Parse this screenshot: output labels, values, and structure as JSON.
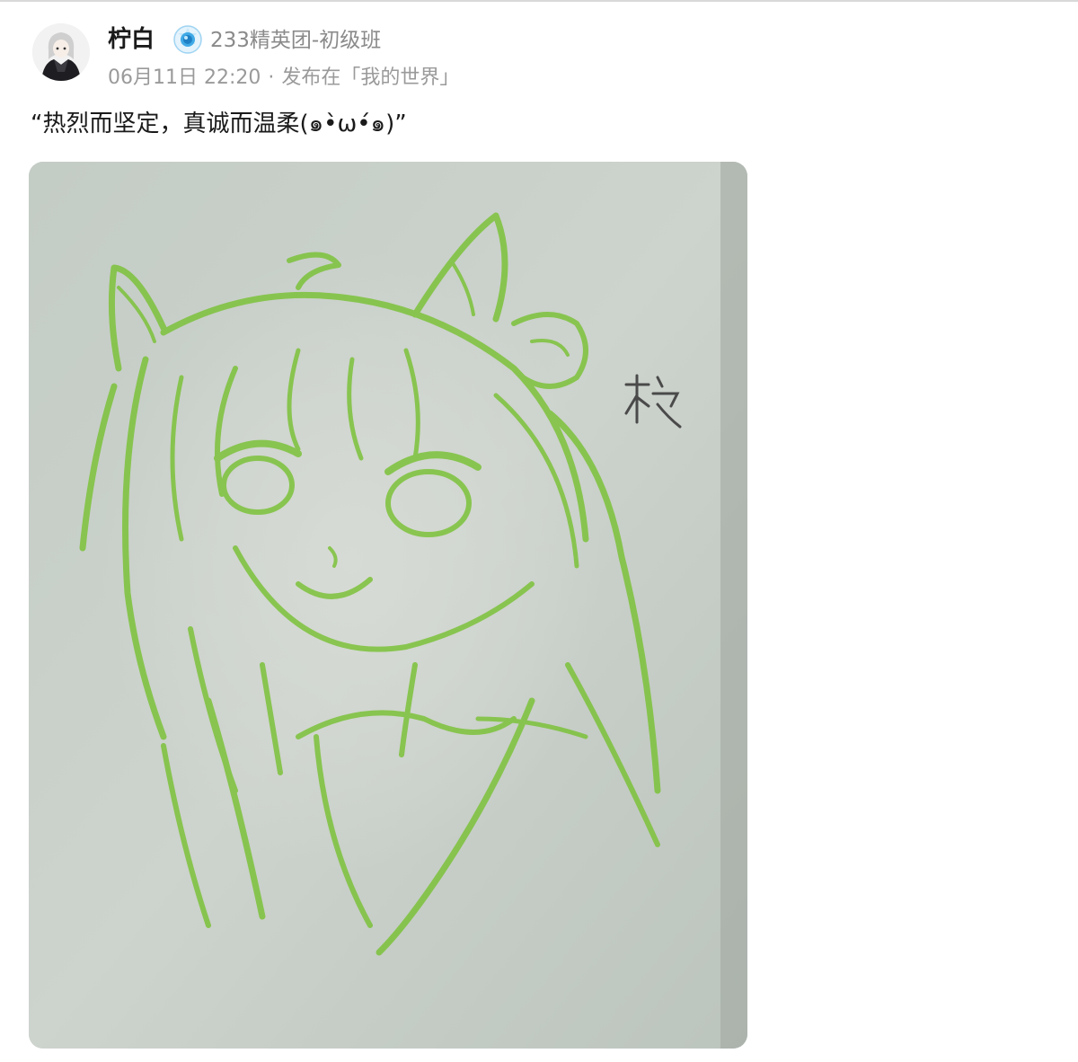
{
  "post": {
    "author": {
      "name": "柠白",
      "badge_icon": "crystal-badge-icon",
      "group": "233精英团-初级班"
    },
    "meta": {
      "date": "06月11日 22:20",
      "separator": "·",
      "published_in": "发布在「我的世界」"
    },
    "content": "“热烈而坚定，真诚而温柔(๑•̀ω•́๑)”",
    "image": {
      "description_icon": "green-pencil-sketch",
      "signature": "柠"
    }
  },
  "colors": {
    "sketch_green": "#7cc23a",
    "paper": "#c8d0ca",
    "badge_blue": "#3fa9e6"
  }
}
